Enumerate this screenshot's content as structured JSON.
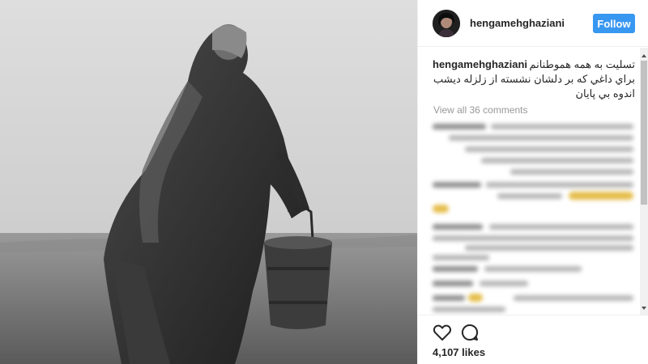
{
  "post": {
    "image": {
      "description_icon": "photo",
      "alt": ""
    }
  },
  "header": {
    "username": "hengamehghaziani",
    "follow_label": "Follow",
    "follow_color": "#3897f0"
  },
  "caption": {
    "username": "hengamehghaziani",
    "text": "تسليت به همه هموطنانم براي داغي كه بر دلشان نشسته از زلزله ديشب اندوه بي پايان"
  },
  "comments": {
    "view_all_label": "View all 36 comments"
  },
  "actions": {
    "like_icon": "heart-icon",
    "comment_icon": "comment-icon",
    "likes_label": "4,107 likes"
  }
}
